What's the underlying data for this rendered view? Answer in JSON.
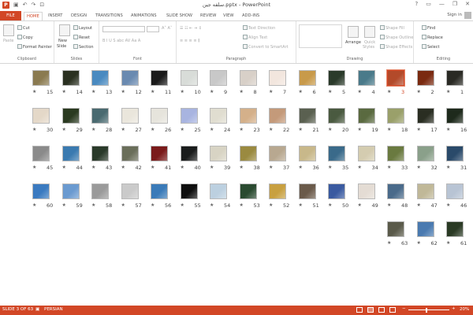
{
  "titlebar": {
    "title": "ﺳﻠﻔﻪ ﺟﻴﻦ.pptx - PowerPoint",
    "app_icon": "powerpoint-icon",
    "qat": [
      "save-icon",
      "undo-icon",
      "redo-icon",
      "start-from-beginning-icon"
    ],
    "window_controls": [
      "?",
      "▭",
      "—",
      "❐",
      "✕"
    ]
  },
  "tabs": {
    "file": "FILE",
    "items": [
      "HOME",
      "INSERT",
      "DESIGN",
      "TRANSITIONS",
      "ANIMATIONS",
      "SLIDE SHOW",
      "REVIEW",
      "VIEW",
      "ADD-INS"
    ],
    "active": "HOME",
    "signin": "Sign in"
  },
  "ribbon": {
    "clipboard": {
      "label": "Clipboard",
      "paste": "Paste",
      "cut": "Cut",
      "copy": "Copy",
      "format_painter": "Format Painter"
    },
    "slides": {
      "label": "Slides",
      "new_slide": "New",
      "new_slide2": "Slide",
      "layout": "Layout",
      "reset": "Reset",
      "section": "Section"
    },
    "font": {
      "label": "Font"
    },
    "paragraph": {
      "label": "Paragraph",
      "text_direction": "Text Direction",
      "align_text": "Align Text",
      "convert": "Convert to SmartArt"
    },
    "drawing": {
      "label": "Drawing",
      "arrange": "Arrange",
      "quick_styles": "Quick",
      "quick_styles2": "Styles",
      "shape_fill": "Shape Fill",
      "shape_outline": "Shape Outline",
      "shape_effects": "Shape Effects"
    },
    "editing": {
      "label": "Editing",
      "find": "Find",
      "replace": "Replace",
      "select": "Select"
    }
  },
  "slides": [
    {
      "n": "1",
      "c": "#2a2a24"
    },
    {
      "n": "2",
      "c": "#7a2a10"
    },
    {
      "n": "3",
      "c": "#b34a2a",
      "selected": true
    },
    {
      "n": "4",
      "c": "#4a7a8a"
    },
    {
      "n": "5",
      "c": "#2a3a2a"
    },
    {
      "n": "6",
      "c": "#c89a4a"
    },
    {
      "n": "7",
      "c": "#f2e6de"
    },
    {
      "n": "8",
      "c": "#d8d0c8"
    },
    {
      "n": "9",
      "c": "#c8c8c8"
    },
    {
      "n": "10",
      "c": "#d8dcd8"
    },
    {
      "n": "11",
      "c": "#1a1a1a"
    },
    {
      "n": "12",
      "c": "#6a8ab0"
    },
    {
      "n": "13",
      "c": "#4a8ac0"
    },
    {
      "n": "14",
      "c": "#2a3020"
    },
    {
      "n": "15",
      "c": "#8a7a50"
    },
    {
      "n": "16",
      "c": "#1e2a1c"
    },
    {
      "n": "17",
      "c": "#2a2e22"
    },
    {
      "n": "18",
      "c": "#9aa06a"
    },
    {
      "n": "19",
      "c": "#5a6a40"
    },
    {
      "n": "20",
      "c": "#4a5a40"
    },
    {
      "n": "21",
      "c": "#5a6050"
    },
    {
      "n": "22",
      "c": "#c49a7a"
    },
    {
      "n": "23",
      "c": "#d4b08a"
    },
    {
      "n": "24",
      "c": "#e0ddd0"
    },
    {
      "n": "25",
      "c": "#a8b4e0"
    },
    {
      "n": "26",
      "c": "#e6e4dc"
    },
    {
      "n": "27",
      "c": "#eae6dc"
    },
    {
      "n": "28",
      "c": "#4a6a70"
    },
    {
      "n": "29",
      "c": "#2a3a20"
    },
    {
      "n": "30",
      "c": "#e4d8c8"
    },
    {
      "n": "31",
      "c": "#2a4a6a"
    },
    {
      "n": "32",
      "c": "#8aa08a"
    },
    {
      "n": "33",
      "c": "#6a7a40"
    },
    {
      "n": "34",
      "c": "#d4ccb0"
    },
    {
      "n": "35",
      "c": "#3a6a8a"
    },
    {
      "n": "36",
      "c": "#c8b88a"
    },
    {
      "n": "37",
      "c": "#b8a890"
    },
    {
      "n": "38",
      "c": "#9a8a40"
    },
    {
      "n": "39",
      "c": "#d8d4c4"
    },
    {
      "n": "40",
      "c": "#1a1c1c"
    },
    {
      "n": "41",
      "c": "#7a1a1a"
    },
    {
      "n": "42",
      "c": "#6a6e5a"
    },
    {
      "n": "43",
      "c": "#2a3a2a"
    },
    {
      "n": "44",
      "c": "#3a7ab0"
    },
    {
      "n": "45",
      "c": "#8a8a8a"
    },
    {
      "n": "46",
      "c": "#b8c4d4"
    },
    {
      "n": "47",
      "c": "#c0b898"
    },
    {
      "n": "48",
      "c": "#4a6a8a"
    },
    {
      "n": "49",
      "c": "#e4dcd4"
    },
    {
      "n": "50",
      "c": "#3a5aa0"
    },
    {
      "n": "51",
      "c": "#6a5a4a"
    },
    {
      "n": "52",
      "c": "#c8a040"
    },
    {
      "n": "53",
      "c": "#2a4a30"
    },
    {
      "n": "54",
      "c": "#bcd0e0"
    },
    {
      "n": "55",
      "c": "#0e0e0e"
    },
    {
      "n": "56",
      "c": "#3a7ab8"
    },
    {
      "n": "57",
      "c": "#cacaca"
    },
    {
      "n": "58",
      "c": "#9a9a9a"
    },
    {
      "n": "59",
      "c": "#6a9ad0"
    },
    {
      "n": "60",
      "c": "#3a7ac0"
    },
    {
      "n": "61",
      "c": "#2a3a24"
    },
    {
      "n": "62",
      "c": "#4a7ab0"
    },
    {
      "n": "63",
      "c": "#5a5a4a"
    }
  ],
  "status": {
    "slide_of": "SLIDE 3 OF 63",
    "language": "PERSIAN",
    "zoom": "20%",
    "zoom_fraction": 0.2
  },
  "colors": {
    "accent": "#d24726"
  }
}
